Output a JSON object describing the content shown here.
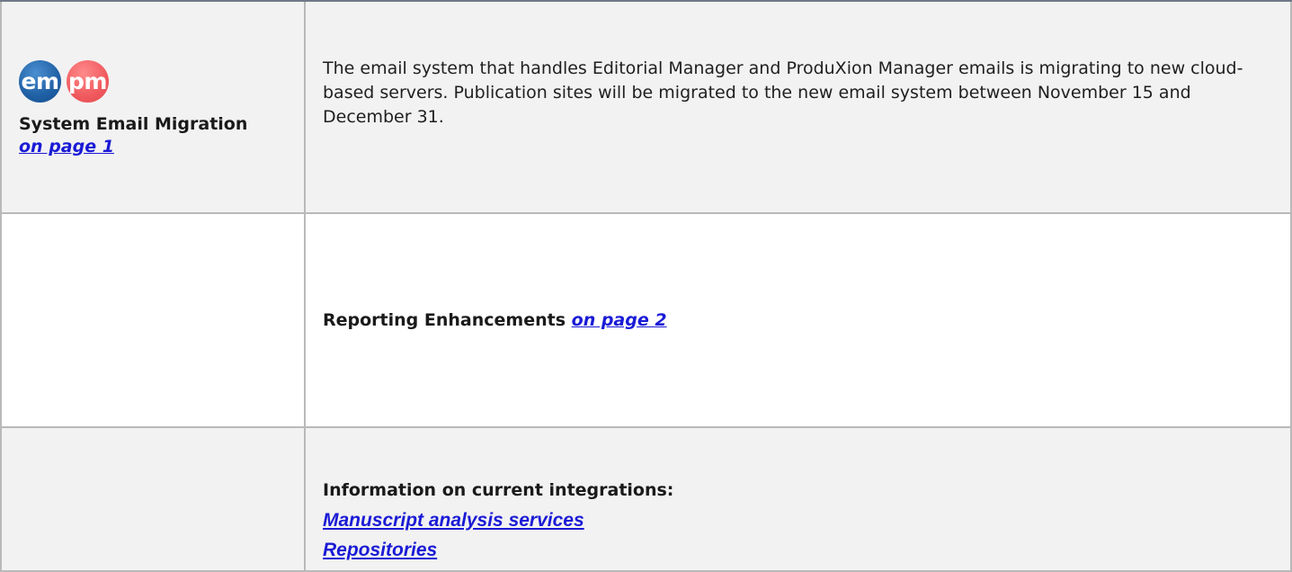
{
  "email_migration": {
    "badges": {
      "em_label": "em",
      "pm_label": "pm",
      "em_color": "#1f5fa4",
      "pm_color": "#f05a5e"
    },
    "title": "System Email Migration",
    "page_link": "on page 1",
    "description": "The email system that handles Editorial Manager and ProduXion Manager emails is migrating to new cloud-based servers.  Publication sites will be migrated to the new email system between November 15 and December 31."
  },
  "reporting": {
    "title": "Reporting Enhancements",
    "page_link": "on page 2"
  },
  "integrations": {
    "heading": "Information on current integrations:",
    "links": [
      "Manuscript analysis services",
      "Repositories"
    ]
  },
  "colors": {
    "link": "#1a1ad6",
    "row_gray": "#f2f2f2",
    "border": "#b9b9b9"
  }
}
